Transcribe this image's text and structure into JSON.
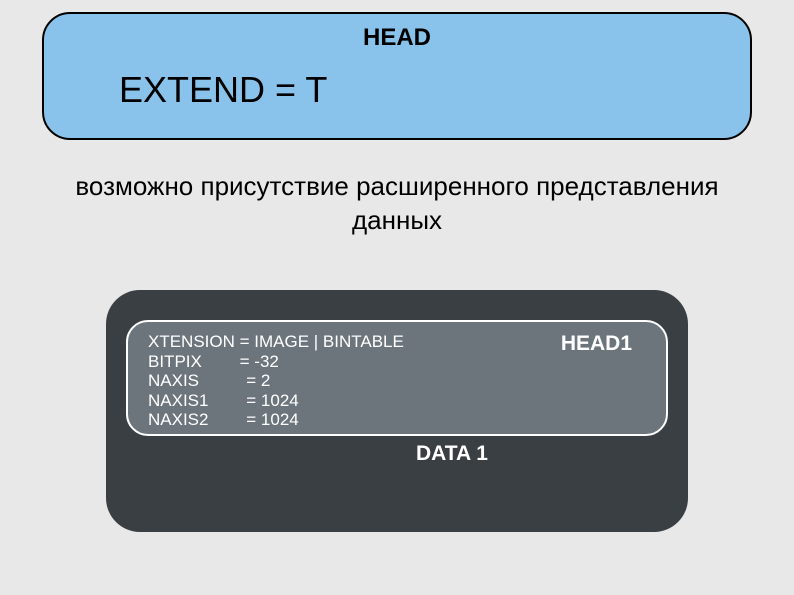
{
  "head_box": {
    "title": "HEAD",
    "extend_line": "EXTEND = T"
  },
  "description": {
    "line1": "возможно присутствие расширенного представления",
    "line2": "данных"
  },
  "extension_block": {
    "title": "HEAD1",
    "data_label": "DATA\n1",
    "kv": {
      "xtension": "XTENSION = IMAGE | BINTABLE",
      "bitpix": "BITPIX        = -32",
      "naxis": "NAXIS          = 2",
      "naxis1": "NAXIS1        = 1024",
      "naxis2": "NAXIS2        = 1024"
    }
  }
}
